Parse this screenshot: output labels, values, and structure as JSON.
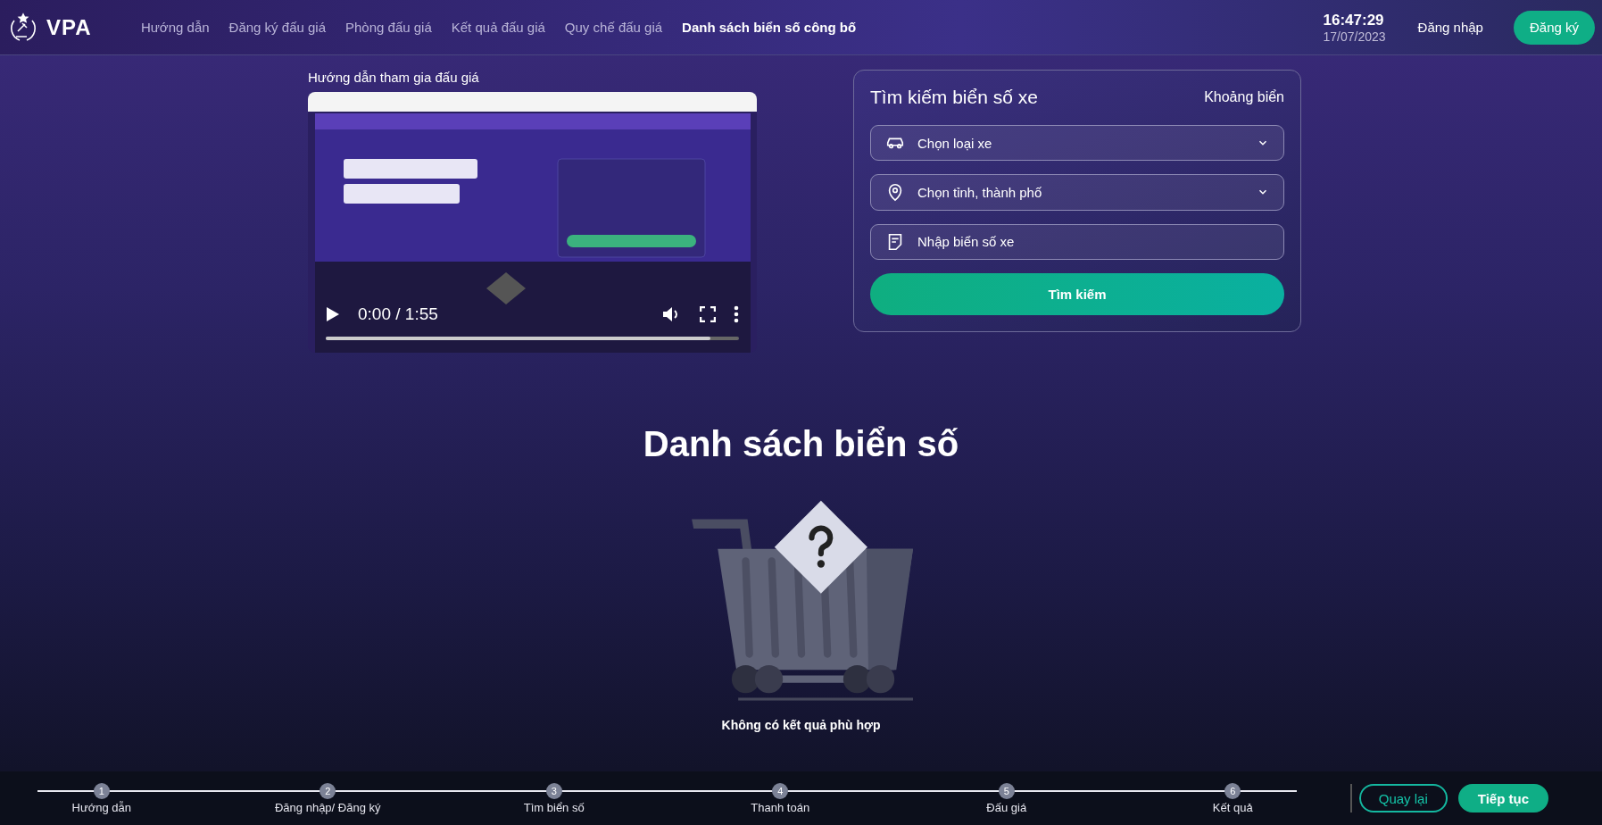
{
  "header": {
    "logo": "VPA",
    "nav": [
      {
        "label": "Hướng dẫn",
        "selected": false
      },
      {
        "label": "Đăng ký đấu giá",
        "selected": false
      },
      {
        "label": "Phòng đấu giá",
        "selected": false
      },
      {
        "label": "Kết quả đấu giá",
        "selected": false
      },
      {
        "label": "Quy chế đấu giá",
        "selected": false
      },
      {
        "label": "Danh sách biển số công bố",
        "selected": true
      }
    ],
    "time": "16:47:29",
    "date": "17/07/2023",
    "login": "Đăng nhập",
    "register": "Đăng ký"
  },
  "video": {
    "title": "Hướng dẫn tham gia đấu giá",
    "kind": "picture",
    "time": "0:00 / 1:55",
    "progress": {
      "level": 0.93
    }
  },
  "search": {
    "title": "Tìm kiếm biển số xe",
    "range_link": "Khoảng biển",
    "fields": [
      {
        "kind": "select",
        "placeholder": "Chọn loại xe"
      },
      {
        "kind": "select",
        "placeholder": "Chọn tỉnh, thành phố"
      },
      {
        "kind": "input",
        "placeholder": "Nhập biển số xe"
      }
    ],
    "button": "Tìm kiếm"
  },
  "results": {
    "title": "Danh sách biển số",
    "empty": "Không có kết quả phù hợp"
  },
  "steps": [
    {
      "number": "1",
      "label": "Hướng dẫn"
    },
    {
      "number": "2",
      "label": "Đăng nhập/ Đăng ký"
    },
    {
      "number": "3",
      "label": "Tìm biển số"
    },
    {
      "number": "4",
      "label": "Thanh toán"
    },
    {
      "number": "5",
      "label": "Đấu giá"
    },
    {
      "number": "6",
      "label": "Kết quả"
    }
  ],
  "footer_buttons": [
    {
      "kind": "outline",
      "label": "Quay lại"
    },
    {
      "kind": "filled",
      "label": "Tiếp tục"
    }
  ]
}
